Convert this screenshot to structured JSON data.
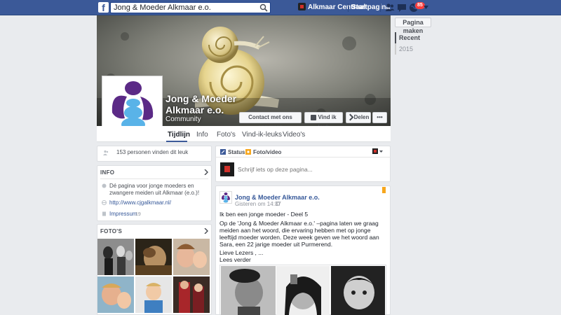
{
  "topbar": {
    "search_value": "Jong & Moeder Alkmaar e.o.",
    "profile_label": "Alkmaar Centraal",
    "home_label": "Startpagina",
    "notif_count": "85"
  },
  "sidebar": {
    "make_page": "Pagina maken",
    "timeline": [
      "Recent",
      "2015"
    ]
  },
  "page": {
    "name": "Jong & Moeder Alkmaar e.o.",
    "category": "Community",
    "buttons": {
      "contact": "Contact met ons opnemen",
      "like": "Vind ik leuk",
      "share": "Delen",
      "more": "•••"
    },
    "tabs": [
      "Tijdlijn",
      "Info",
      "Foto's",
      "Vind-ik-leuks",
      "Video's"
    ]
  },
  "left": {
    "likes": "153 personen vinden dit leuk",
    "info_header": "INFO",
    "info_desc": "Dé pagina voor jonge moeders en zwangere meiden uit Alkmaar (e.o.)!",
    "website": "http://www.cjgalkmaar.nl/",
    "impressum": "Impressum",
    "impressum_count": "19",
    "photos_header": "FOTO'S"
  },
  "composer": {
    "status": "Status",
    "photo": "Foto/video",
    "placeholder": "Schrijf iets op deze pagina..."
  },
  "post": {
    "author": "Jong & Moeder Alkmaar e.o.",
    "time": "Gisteren om 14:37",
    "title": "Ik ben een jonge moeder - Deel 5",
    "body": "Op de 'Jong & Moeder Alkmaar e.o.' –pagina laten we graag meiden aan het woord, die ervaring hebben met op jonge leeftijd moeder worden. Deze week geven we het woord aan Sara, een 22 jarige moeder uit Purmerend.",
    "greeting": "Lieve Lezers , ...",
    "read_more": "Lees verder"
  },
  "colors": {
    "topbar": "#3b5998",
    "link": "#365899",
    "page_bg": "#e9ebee"
  }
}
